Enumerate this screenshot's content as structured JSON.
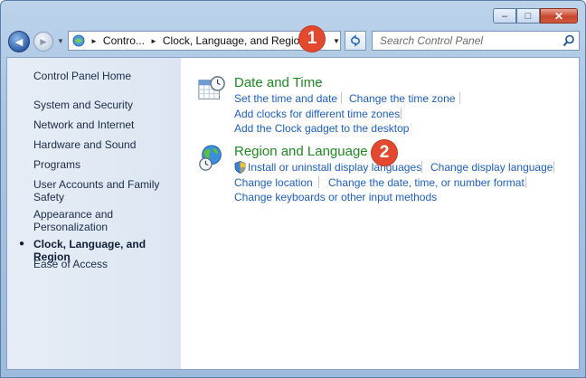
{
  "titlebar": {
    "minimize": "–",
    "maximize": "□",
    "close": "✕"
  },
  "nav": {
    "back": "◄",
    "forward": "►"
  },
  "address": {
    "crumbs": [
      "Contro...",
      "Clock, Language, and Region"
    ],
    "separator": "►",
    "dropdown": "▼"
  },
  "search": {
    "placeholder": "Search Control Panel"
  },
  "badges": [
    "1",
    "2"
  ],
  "sidebar": {
    "home": "Control Panel Home",
    "items": [
      {
        "label": "System and Security"
      },
      {
        "label": "Network and Internet"
      },
      {
        "label": "Hardware and Sound"
      },
      {
        "label": "Programs"
      },
      {
        "label": "User Accounts and Family Safety"
      },
      {
        "label": "Appearance and Personalization"
      },
      {
        "label": "Clock, Language, and Region",
        "current": true
      },
      {
        "label": "Ease of Access"
      }
    ]
  },
  "categories": [
    {
      "title": "Date and Time",
      "icon": "clock-calendar-icon",
      "links": [
        "Set the time and date",
        "Change the time zone",
        "Add clocks for different time zones",
        "Add the Clock gadget to the desktop"
      ]
    },
    {
      "title": "Region and Language",
      "icon": "globe-clock-icon",
      "links": [
        "Install or uninstall display languages",
        "Change display language",
        "Change location",
        "Change the date, time, or number format",
        "Change keyboards or other input methods"
      ]
    }
  ],
  "colors": {
    "category_title": "#1e8a22",
    "link": "#1d5fc2",
    "badge": "#e2492f",
    "sidebar_bg": "#dce6f2"
  }
}
